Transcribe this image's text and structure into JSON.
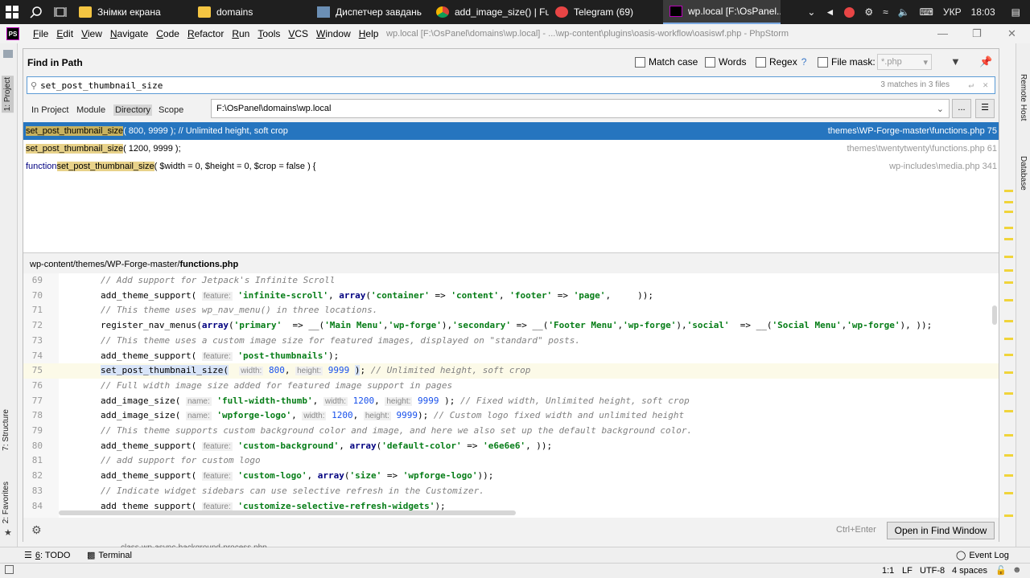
{
  "taskbar": {
    "tasks": [
      {
        "label": "Знімки екрана",
        "icon": "folder-icon"
      },
      {
        "label": "domains",
        "icon": "folder-icon"
      },
      {
        "label": "Диспетчер завдань",
        "icon": "task-manager-icon"
      },
      {
        "label": "add_image_size() | Fu...",
        "icon": "chrome-icon"
      },
      {
        "label": "Telegram (69)",
        "icon": "telegram-icon"
      },
      {
        "label": "wp.local [F:\\OsPanel...",
        "icon": "phpstorm-icon"
      }
    ],
    "language": "УКР",
    "time": "18:03"
  },
  "menubar": {
    "logo": "PS",
    "items": [
      {
        "u": "F",
        "rest": "ile"
      },
      {
        "u": "E",
        "rest": "dit"
      },
      {
        "u": "V",
        "rest": "iew"
      },
      {
        "u": "N",
        "rest": "avigate"
      },
      {
        "u": "C",
        "rest": "ode"
      },
      {
        "u": "R",
        "rest": "efactor"
      },
      {
        "u": "R",
        "rest": "un"
      },
      {
        "u": "T",
        "rest": "ools"
      },
      {
        "u": "V",
        "rest": "CS"
      },
      {
        "u": "W",
        "rest": "indow"
      },
      {
        "u": "H",
        "rest": "elp"
      }
    ],
    "window_title": "wp.local [F:\\OsPanel\\domains\\wp.local] - ...\\wp-content\\plugins\\oasis-workflow\\oasiswf.php - PhpStorm"
  },
  "side_tabs": {
    "project": "1: Project",
    "structure": "7: Structure",
    "favorites": "2: Favorites",
    "remote_host": "Remote Host",
    "database": "Database"
  },
  "find": {
    "title": "Find in Path",
    "options": {
      "match_case": "Match case",
      "words": "Words",
      "regex": "Regex",
      "regex_help": "?",
      "file_mask": "File mask:",
      "file_mask_value": "*.php"
    },
    "query": "set_post_thumbnail_size",
    "match_count": "3 matches in 3 files",
    "scopes": {
      "in_project": "In Project",
      "module": "Module",
      "directory": "Directory",
      "scope": "Scope"
    },
    "directory": "F:\\OsPanel\\domains\\wp.local",
    "browse": "...",
    "results": [
      {
        "pre": "",
        "match": "set_post_thumbnail_size",
        "post": "( 800, 9999 ); // Unlimited height, soft crop",
        "path": "themes\\WP-Forge-master\\functions.php 75"
      },
      {
        "pre": "",
        "match": "set_post_thumbnail_size",
        "post": "( 1200, 9999 );",
        "path": "themes\\twentytwenty\\functions.php 61"
      },
      {
        "pre": "function ",
        "match": "set_post_thumbnail_size",
        "post": "( $width = 0, $height = 0, $crop = false ) {",
        "path": "wp-includes\\media.php 341"
      }
    ],
    "preview_path_prefix": "wp-content/themes/WP-Forge-master/",
    "preview_file": "functions.php",
    "shortcut": "Ctrl+Enter",
    "open_button": "Open in Find Window"
  },
  "code_lines": [
    69,
    70,
    71,
    72,
    73,
    74,
    75,
    76,
    77,
    78,
    79,
    80,
    81,
    82,
    83,
    84
  ],
  "code": {
    "l69": "// Add support for Jetpack's Infinite Scroll",
    "l70a": "add_theme_support( ",
    "l70h": "feature:",
    "l70s": "'infinite-scroll'",
    "l70b": ", ",
    "l70k": "array",
    "l70c": "(",
    "l70s2": "'container'",
    "l70d": " => ",
    "l70s3": "'content'",
    "l70e": ", ",
    "l70s4": "'footer'",
    "l70f": " => ",
    "l70s5": "'page'",
    "l70g": ",     ));",
    "l71": "// This theme uses wp_nav_menu() in three locations.",
    "l72a": "register_nav_menus(",
    "l72k": "array",
    "l72b": "(",
    "l72s1": "'primary'",
    "l72c": "  => __(",
    "l72s2": "'Main Menu'",
    "l72d": ",",
    "l72s3": "'wp-forge'",
    "l72e": "),",
    "l72s4": "'secondary'",
    "l72f": " => __(",
    "l72s5": "'Footer Menu'",
    "l72g": ",",
    "l72s6": "'wp-forge'",
    "l72h": "),",
    "l72s7": "'social'",
    "l72i": "  => __(",
    "l72s8": "'Social Menu'",
    "l72j": ",",
    "l72s9": "'wp-forge'",
    "l72l": "), ));",
    "l73": "// This theme uses a custom image size for featured images, displayed on \"standard\" posts.",
    "l74a": "add_theme_support( ",
    "l74h": "feature:",
    "l74s": "'post-thumbnails'",
    "l74b": ");",
    "l75a": "set_post_thumbnail_size(",
    "l75h1": "width:",
    "l75n1": "800",
    "l75b": ", ",
    "l75h2": "height:",
    "l75n2": "9999",
    "l75c": " ",
    "l75p": ")",
    "l75d": "; ",
    "l75cm": "// Unlimited height, soft crop",
    "l76": "// Full width image size added for featured image support in pages",
    "l77a": "add_image_size( ",
    "l77h1": "name:",
    "l77s": "'full-width-thumb'",
    "l77b": ", ",
    "l77h2": "width:",
    "l77n1": "1200",
    "l77c": ", ",
    "l77h3": "height:",
    "l77n2": "9999",
    "l77d": " ); ",
    "l77cm": "// Fixed width, Unlimited height, soft crop",
    "l78a": "add_image_size( ",
    "l78h1": "name:",
    "l78s": "'wpforge-logo'",
    "l78b": ", ",
    "l78h2": "width:",
    "l78n1": "1200",
    "l78c": ", ",
    "l78h3": "height:",
    "l78n2": "9999",
    "l78d": "); ",
    "l78cm": "// Custom logo fixed width and unlimited height",
    "l79": "// This theme supports custom background color and image, and here we also set up the default background color.",
    "l80a": "add_theme_support( ",
    "l80h": "feature:",
    "l80s": "'custom-background'",
    "l80b": ", ",
    "l80k": "array",
    "l80c": "(",
    "l80s2": "'default-color'",
    "l80d": " => ",
    "l80s3": "'e6e6e6'",
    "l80e": ", ));",
    "l81": "// add support for custom logo",
    "l82a": "add_theme_support( ",
    "l82h": "feature:",
    "l82s": "'custom-logo'",
    "l82b": ", ",
    "l82k": "array",
    "l82c": "(",
    "l82s2": "'size'",
    "l82d": " => ",
    "l82s3": "'wpforge-logo'",
    "l82e": "));",
    "l83": "// Indicate widget sidebars can use selective refresh in the Customizer.",
    "l84a": "add_theme_support( ",
    "l84h": "feature:",
    "l84s": "'customize-selective-refresh-widgets'",
    "l84b": ");"
  },
  "bottom_tabs": {
    "todo_u": "6",
    "todo": ": TODO",
    "terminal": "Terminal",
    "event_log": "Event Log",
    "hidden_tab": "class-wp-async-background-process.php"
  },
  "status": {
    "position": "1:1",
    "line_sep": "LF",
    "encoding": "UTF-8",
    "indent": "4 spaces"
  }
}
